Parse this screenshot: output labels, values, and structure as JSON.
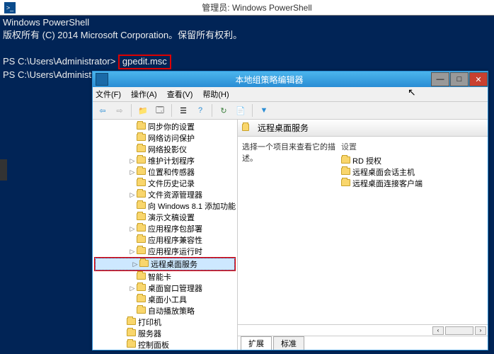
{
  "powershell": {
    "icon_glyph": ">_",
    "title": "管理员: Windows PowerShell",
    "line1": "Windows PowerShell",
    "line2": "版权所有 (C) 2014 Microsoft Corporation。保留所有权利。",
    "prompt1": "PS C:\\Users\\Administrator> ",
    "command": "gpedit.msc",
    "prompt2": "PS C:\\Users\\Administrator>"
  },
  "mmc": {
    "title": "本地组策略编辑器",
    "buttons": {
      "min": "—",
      "max": "□",
      "close": "✕"
    },
    "menu": {
      "file": "文件(F)",
      "action": "操作(A)",
      "view": "查看(V)",
      "help": "帮助(H)"
    },
    "toolbar": {
      "back": "⇦",
      "fwd": "⇨",
      "up": "📁",
      "props": "🗔",
      "list": "☰",
      "help": "?",
      "refresh": "↻",
      "export": "📄",
      "filter": "▼"
    },
    "tree": [
      {
        "ind": 50,
        "exp": "",
        "label": "同步你的设置"
      },
      {
        "ind": 50,
        "exp": "",
        "label": "网络访问保护"
      },
      {
        "ind": 50,
        "exp": "",
        "label": "网络投影仪"
      },
      {
        "ind": 50,
        "exp": "▷",
        "label": "维护计划程序"
      },
      {
        "ind": 50,
        "exp": "▷",
        "label": "位置和传感器"
      },
      {
        "ind": 50,
        "exp": "",
        "label": "文件历史记录"
      },
      {
        "ind": 50,
        "exp": "▷",
        "label": "文件资源管理器"
      },
      {
        "ind": 50,
        "exp": "",
        "label": "向 Windows 8.1 添加功能"
      },
      {
        "ind": 50,
        "exp": "",
        "label": "演示文稿设置"
      },
      {
        "ind": 50,
        "exp": "▷",
        "label": "应用程序包部署"
      },
      {
        "ind": 50,
        "exp": "",
        "label": "应用程序兼容性"
      },
      {
        "ind": 50,
        "exp": "▷",
        "label": "应用程序运行时"
      },
      {
        "ind": 50,
        "exp": "▷",
        "label": "远程桌面服务",
        "sel": true,
        "redbox": true
      },
      {
        "ind": 50,
        "exp": "",
        "label": "智能卡"
      },
      {
        "ind": 50,
        "exp": "▷",
        "label": "桌面窗口管理器"
      },
      {
        "ind": 50,
        "exp": "",
        "label": "桌面小工具"
      },
      {
        "ind": 50,
        "exp": "",
        "label": "自动播放策略"
      },
      {
        "ind": 36,
        "exp": "",
        "label": "打印机"
      },
      {
        "ind": 36,
        "exp": "",
        "label": "服务器"
      },
      {
        "ind": 36,
        "exp": "",
        "label": "控制面板"
      }
    ],
    "right": {
      "header": "远程桌面服务",
      "desc": "选择一个项目来查看它的描述。",
      "list_header": "设置",
      "items": [
        "RD 授权",
        "远程桌面会话主机",
        "远程桌面连接客户端"
      ],
      "tabs": {
        "ext": "扩展",
        "std": "标准"
      }
    }
  }
}
